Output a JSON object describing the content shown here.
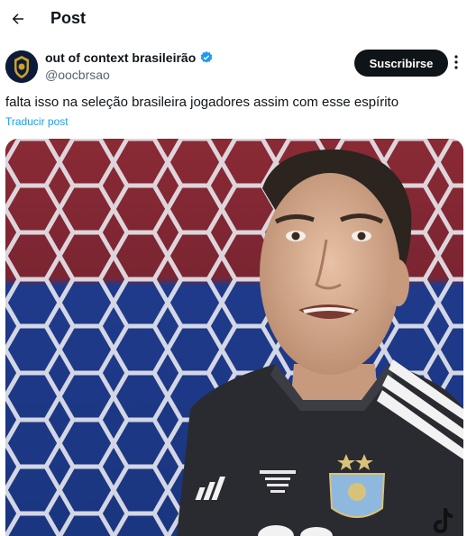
{
  "header": {
    "title": "Post",
    "back_icon": "arrow-left-icon"
  },
  "author": {
    "display_name": "out of context brasileirão",
    "handle": "@oocbrsao",
    "verified_icon": "verified-badge-icon",
    "verified_color": "#1d9bf0"
  },
  "actions": {
    "subscribe_label": "Suscribirse",
    "more_icon": "more-vertical-icon"
  },
  "tweet": {
    "text": "falta isso na seleção brasileira jogadores assim com esse espírito",
    "translate_label": "Traducir post"
  },
  "colors": {
    "accent": "#1d9bf0",
    "button_bg": "#0f1419",
    "muted": "#536471"
  }
}
